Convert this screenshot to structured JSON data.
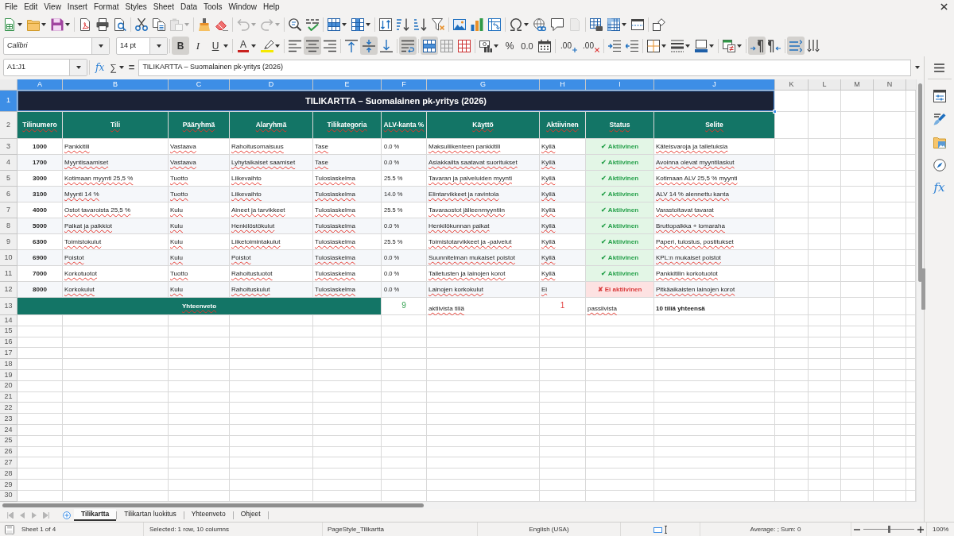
{
  "menu_bar": [
    "File",
    "Edit",
    "View",
    "Insert",
    "Format",
    "Styles",
    "Sheet",
    "Data",
    "Tools",
    "Window",
    "Help"
  ],
  "standard_toolbar": {
    "paste": {
      "disabled": true
    },
    "undo": {
      "disabled": true
    },
    "redo": {
      "disabled": true
    },
    "header_footer": {
      "disabled": true
    }
  },
  "formatting_toolbar": {
    "font_name": "Calibri",
    "font_size": "14 pt",
    "bold": {
      "label": "B",
      "on": true
    },
    "italic": {
      "label": "I",
      "on": false
    },
    "underline": {
      "label": "U",
      "on": false
    },
    "font_color": {
      "label": "A"
    },
    "align_left": {
      "on": false
    },
    "align_center": {
      "on": true
    },
    "align_right": {
      "on": false
    },
    "align_top": {
      "on": false
    },
    "align_middle": {
      "on": true
    },
    "align_bottom": {
      "on": false
    },
    "wrap_text": {
      "on": true
    },
    "merge_and_center": {
      "on": true
    },
    "percent": "%",
    "number": "0.0",
    "add_decimal": ".00",
    "delete_decimal": ".00",
    "ltr": {
      "on": true
    },
    "rtl": {
      "on": false
    },
    "text_horizontal": {
      "on": true
    },
    "text_vertical": {
      "on": false
    }
  },
  "formula_bar": {
    "name_box": "A1:J1",
    "function_wizard": "fx",
    "sum": "∑",
    "equals": "=",
    "content": "TILIKARTTA – Suomalainen pk-yritys (2026)"
  },
  "column_headers": [
    {
      "label": "A",
      "selected": true
    },
    {
      "label": "B",
      "selected": true
    },
    {
      "label": "C",
      "selected": true
    },
    {
      "label": "D",
      "selected": true
    },
    {
      "label": "E",
      "selected": true
    },
    {
      "label": "F",
      "selected": true
    },
    {
      "label": "G",
      "selected": true
    },
    {
      "label": "H",
      "selected": true
    },
    {
      "label": "I",
      "selected": true
    },
    {
      "label": "J",
      "selected": true
    },
    {
      "label": "K",
      "selected": false
    },
    {
      "label": "L",
      "selected": false
    },
    {
      "label": "M",
      "selected": false
    },
    {
      "label": "N",
      "selected": false
    }
  ],
  "row_headers": [
    {
      "label": "1",
      "selected": true
    },
    {
      "label": "2",
      "selected": false
    },
    {
      "label": "3",
      "selected": false
    },
    {
      "label": "4",
      "selected": false
    },
    {
      "label": "5",
      "selected": false
    },
    {
      "label": "6",
      "selected": false
    },
    {
      "label": "7",
      "selected": false
    },
    {
      "label": "8",
      "selected": false
    },
    {
      "label": "9",
      "selected": false
    },
    {
      "label": "10",
      "selected": false
    },
    {
      "label": "11",
      "selected": false
    },
    {
      "label": "12",
      "selected": false
    },
    {
      "label": "13",
      "selected": false
    },
    {
      "label": "14",
      "selected": false
    },
    {
      "label": "15",
      "selected": false
    },
    {
      "label": "16",
      "selected": false
    },
    {
      "label": "17",
      "selected": false
    },
    {
      "label": "18",
      "selected": false
    },
    {
      "label": "19",
      "selected": false
    },
    {
      "label": "20",
      "selected": false
    },
    {
      "label": "21",
      "selected": false
    },
    {
      "label": "22",
      "selected": false
    },
    {
      "label": "23",
      "selected": false
    },
    {
      "label": "24",
      "selected": false
    },
    {
      "label": "25",
      "selected": false
    },
    {
      "label": "26",
      "selected": false
    },
    {
      "label": "27",
      "selected": false
    },
    {
      "label": "28",
      "selected": false
    },
    {
      "label": "29",
      "selected": false
    },
    {
      "label": "30",
      "selected": false
    }
  ],
  "sheet": {
    "title": "TILIKARTTA – Suomalainen pk-yritys (2026)",
    "headers": [
      "Tilinumero",
      "Tili",
      "Pääryhmä",
      "Alaryhmä",
      "Tilikategoria",
      "ALV-kanta %",
      "Käyttö",
      "Aktiivinen",
      "Status",
      "Selite"
    ],
    "rows": [
      {
        "cells": [
          "1000",
          "Pankkitili",
          "Vastaava",
          "Rahoitusomaisuus",
          "Tase",
          "0.0 %",
          "Maksuliikenteen pankkitili",
          "Kyllä",
          "✔ Aktiivinen",
          "Käteisvaroja ja talletuksia"
        ],
        "active": true
      },
      {
        "cells": [
          "1700",
          "Myyntisaamiset",
          "Vastaava",
          "Lyhytaikaiset saamiset",
          "Tase",
          "0.0 %",
          "Asiakkailta saatavat suoritukset",
          "Kyllä",
          "✔ Aktiivinen",
          "Avoinna olevat myyntilaskut"
        ],
        "active": true
      },
      {
        "cells": [
          "3000",
          "Kotimaan myynti 25,5 %",
          "Tuotto",
          "Liikevaihto",
          "Tuloslaskelma",
          "25.5 %",
          "Tavaran ja palveluiden myynti",
          "Kyllä",
          "✔ Aktiivinen",
          "Kotimaan ALV 25,5 % myynti"
        ],
        "active": true
      },
      {
        "cells": [
          "3100",
          "Myynti 14 %",
          "Tuotto",
          "Liikevaihto",
          "Tuloslaskelma",
          "14.0 %",
          "Elintarvikkeet ja ravintola",
          "Kyllä",
          "✔ Aktiivinen",
          "ALV 14 % alennettu kanta"
        ],
        "active": true
      },
      {
        "cells": [
          "4000",
          "Ostot tavaroista 25,5 %",
          "Kulu",
          "Aineet ja tarvikkeet",
          "Tuloslaskelma",
          "25.5 %",
          "Tavaraostot jälleenmyyntiin",
          "Kyllä",
          "✔ Aktiivinen",
          "Varastoitavat tavarat"
        ],
        "active": true
      },
      {
        "cells": [
          "5000",
          "Palkat ja palkkiot",
          "Kulu",
          "Henkilöstökulut",
          "Tuloslaskelma",
          "0.0 %",
          "Henkilökunnan palkat",
          "Kyllä",
          "✔ Aktiivinen",
          "Bruttopalkka + lomaraha"
        ],
        "active": true
      },
      {
        "cells": [
          "6300",
          "Toimistokulut",
          "Kulu",
          "Liiketoimintakulut",
          "Tuloslaskelma",
          "25.5 %",
          "Toimistotarvikkeet ja -palvelut",
          "Kyllä",
          "✔ Aktiivinen",
          "Paperi, tulostus, postitukset"
        ],
        "active": true
      },
      {
        "cells": [
          "6900",
          "Poistot",
          "Kulu",
          "Poistot",
          "Tuloslaskelma",
          "0.0 %",
          "Suunnitelman mukaiset poistot",
          "Kyllä",
          "✔ Aktiivinen",
          "KPL:n mukaiset poistot"
        ],
        "active": true
      },
      {
        "cells": [
          "7000",
          "Korkotuotot",
          "Tuotto",
          "Rahoitustuotot",
          "Tuloslaskelma",
          "0.0 %",
          "Talletusten ja lainojen korot",
          "Kyllä",
          "✔ Aktiivinen",
          "Pankkitilin korkotuotot"
        ],
        "active": true
      },
      {
        "cells": [
          "8000",
          "Korkokulut",
          "Kulu",
          "Rahoituskulut",
          "Tuloslaskelma",
          "0.0 %",
          "Lainojen korkokulut",
          "Ei",
          "✘ Ei aktiivinen",
          "Pitkäaikaisten lainojen korot"
        ],
        "active": false
      }
    ],
    "summary": {
      "label": "Yhteenveto",
      "active_count": "9",
      "active_text": "aktiivista tiliä",
      "inactive_count": "1",
      "inactive_text": "passiivista",
      "total_text": "10 tiliä yhteensä"
    }
  },
  "sheet_tabs": [
    {
      "label": "Tilikartta",
      "selected": true
    },
    {
      "label": "Tilikartan luokitus",
      "selected": false
    },
    {
      "label": "Yhteenveto",
      "selected": false
    },
    {
      "label": "Ohjeet",
      "selected": false
    }
  ],
  "sidebar": {
    "functions": "fx"
  },
  "status_bar": {
    "sheet_position": "Sheet 1 of 4",
    "selection": "Selected: 1 row, 10 columns",
    "page_style": "PageStyle_Tilikartta",
    "language": "English (USA)",
    "statistics": "Average: ; Sum: 0",
    "zoom_slider": {
      "level": 0.5
    },
    "zoom": "100%"
  }
}
